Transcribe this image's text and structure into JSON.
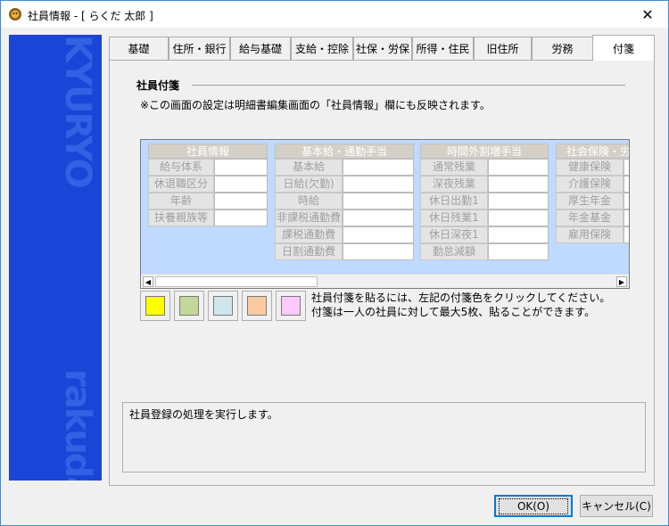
{
  "window": {
    "title": "社員情報 - [ らくだ 太郎 ]",
    "close_glyph": "✕"
  },
  "sidebar": {
    "watermark_top": "KYURYO",
    "watermark_bottom": "rakuda"
  },
  "tabs": [
    {
      "label": "基礎",
      "active": false
    },
    {
      "label": "住所・銀行",
      "active": false
    },
    {
      "label": "給与基礎",
      "active": false
    },
    {
      "label": "支給・控除",
      "active": false
    },
    {
      "label": "社保・労保",
      "active": false
    },
    {
      "label": "所得・住民",
      "active": false
    },
    {
      "label": "旧住所",
      "active": false
    },
    {
      "label": "労務",
      "active": false
    },
    {
      "label": "付箋",
      "active": true
    }
  ],
  "section": {
    "title": "社員付箋",
    "note": "※この画面の設定は明細書編集画面の「社員情報」欄にも反映されます。"
  },
  "grid": {
    "groups": [
      {
        "header": "社員情報",
        "rows": [
          "給与体系",
          "休退職区分",
          "年齢",
          "扶養親族等"
        ]
      },
      {
        "header": "基本給・通勤手当",
        "rows": [
          "基本給",
          "日給(欠勤)",
          "時給",
          "非課税通勤費",
          "課税通勤費",
          "日割通勤費"
        ]
      },
      {
        "header": "時間外割増手当",
        "rows": [
          "通常残業",
          "深夜残業",
          "休日出勤1",
          "休日残業1",
          "休日深夜1",
          "勤怠減額"
        ]
      },
      {
        "header": "社会保険・労",
        "rows": [
          "健康保険",
          "介護保険",
          "厚生年金",
          "年金基金",
          "雇用保険"
        ]
      }
    ]
  },
  "scrollbar": {
    "left_arrow": "◀",
    "right_arrow": "▶"
  },
  "swatches": [
    {
      "name": "yellow",
      "color": "#ffff00"
    },
    {
      "name": "green",
      "color": "#c4d79b"
    },
    {
      "name": "blue",
      "color": "#cfe6ee"
    },
    {
      "name": "orange",
      "color": "#fbcaa2"
    },
    {
      "name": "pink",
      "color": "#ffc8ff"
    }
  ],
  "instructions": {
    "line1": "社員付箋を貼るには、左記の付箋色をクリックしてください。",
    "line2": "付箋は一人の社員に対して最大5枚、貼ることができます。"
  },
  "status": {
    "message": "社員登録の処理を実行します。"
  },
  "buttons": {
    "ok": "OK(O)",
    "cancel": "キャンセル(C)"
  }
}
